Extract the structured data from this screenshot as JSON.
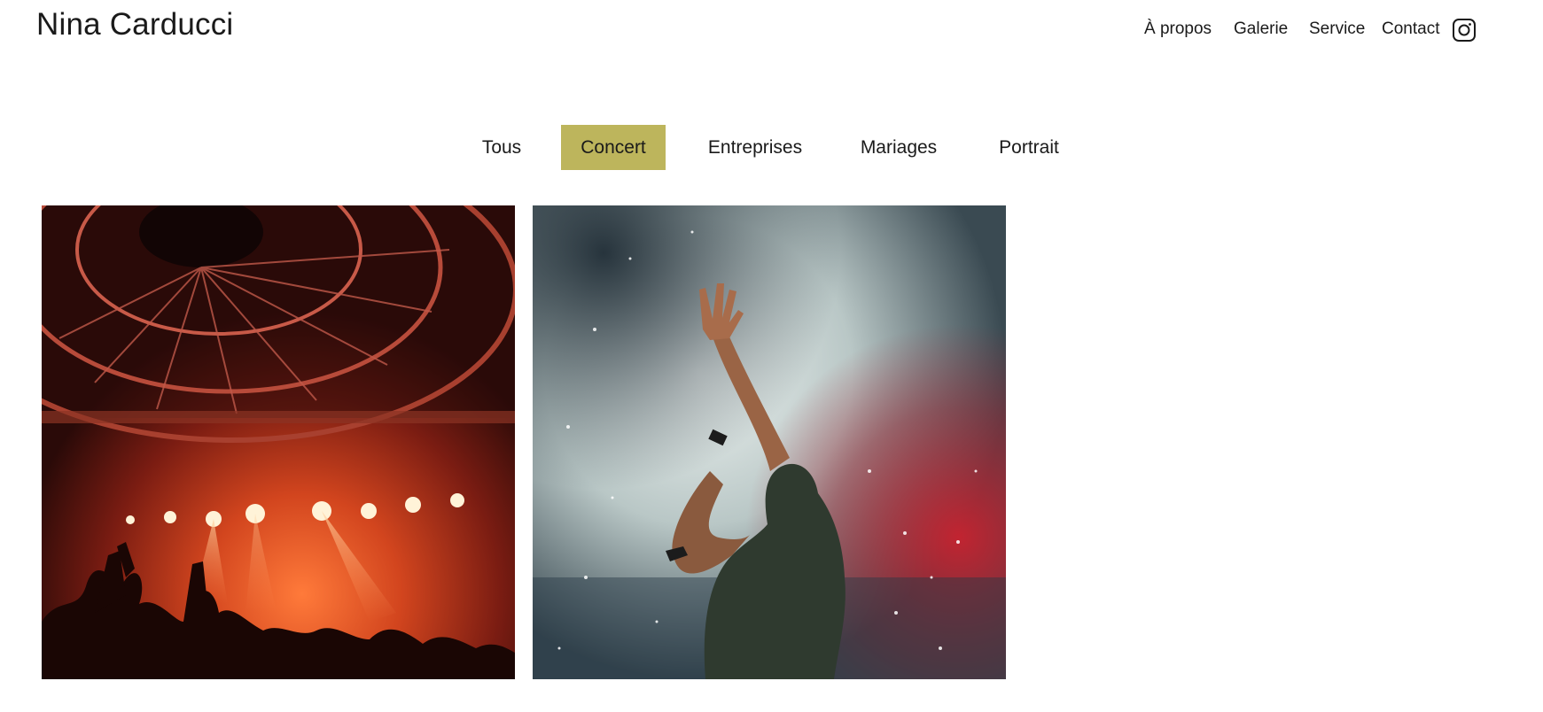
{
  "header": {
    "brand": "Nina Carducci",
    "nav": {
      "about": "À propos",
      "gallery": "Galerie",
      "service": "Service",
      "contact": "Contact"
    },
    "social_icon": "instagram-icon"
  },
  "filters": {
    "items": [
      "Tous",
      "Concert",
      "Entreprises",
      "Mariages",
      "Portrait"
    ],
    "active": "Concert",
    "active_color": "#bdb55c"
  },
  "gallery": {
    "images": [
      {
        "subject": "concert-stage-lights"
      },
      {
        "subject": "singer-raising-hand-smoke"
      }
    ]
  }
}
